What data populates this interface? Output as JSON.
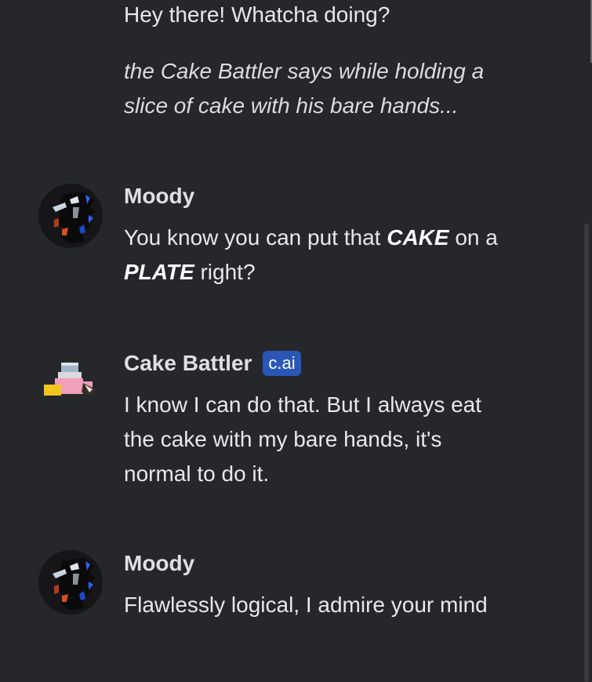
{
  "messages": [
    {
      "sender": "",
      "text_plain": "Hey there! Whatcha doing?",
      "action_text": "the Cake Battler says while holding a slice of cake with his bare hands..."
    },
    {
      "sender": "Moody",
      "text_parts": [
        "You know you can put that ",
        "CAKE",
        " on a ",
        "PLATE",
        " right?"
      ]
    },
    {
      "sender": "Cake Battler",
      "badge": "c.ai",
      "text_plain": "I know I can do that. But I always eat the cake with my bare hands, it's normal to do it."
    },
    {
      "sender": "Moody",
      "text_plain": "Flawlessly logical, I admire your mind"
    }
  ],
  "icons": {
    "moody_avatar": "moody-avatar-icon",
    "cake_battler_avatar": "cake-battler-avatar-icon"
  },
  "colors": {
    "background": "#26272b",
    "text": "#e8e8ea",
    "badge": "#2a56b8"
  }
}
